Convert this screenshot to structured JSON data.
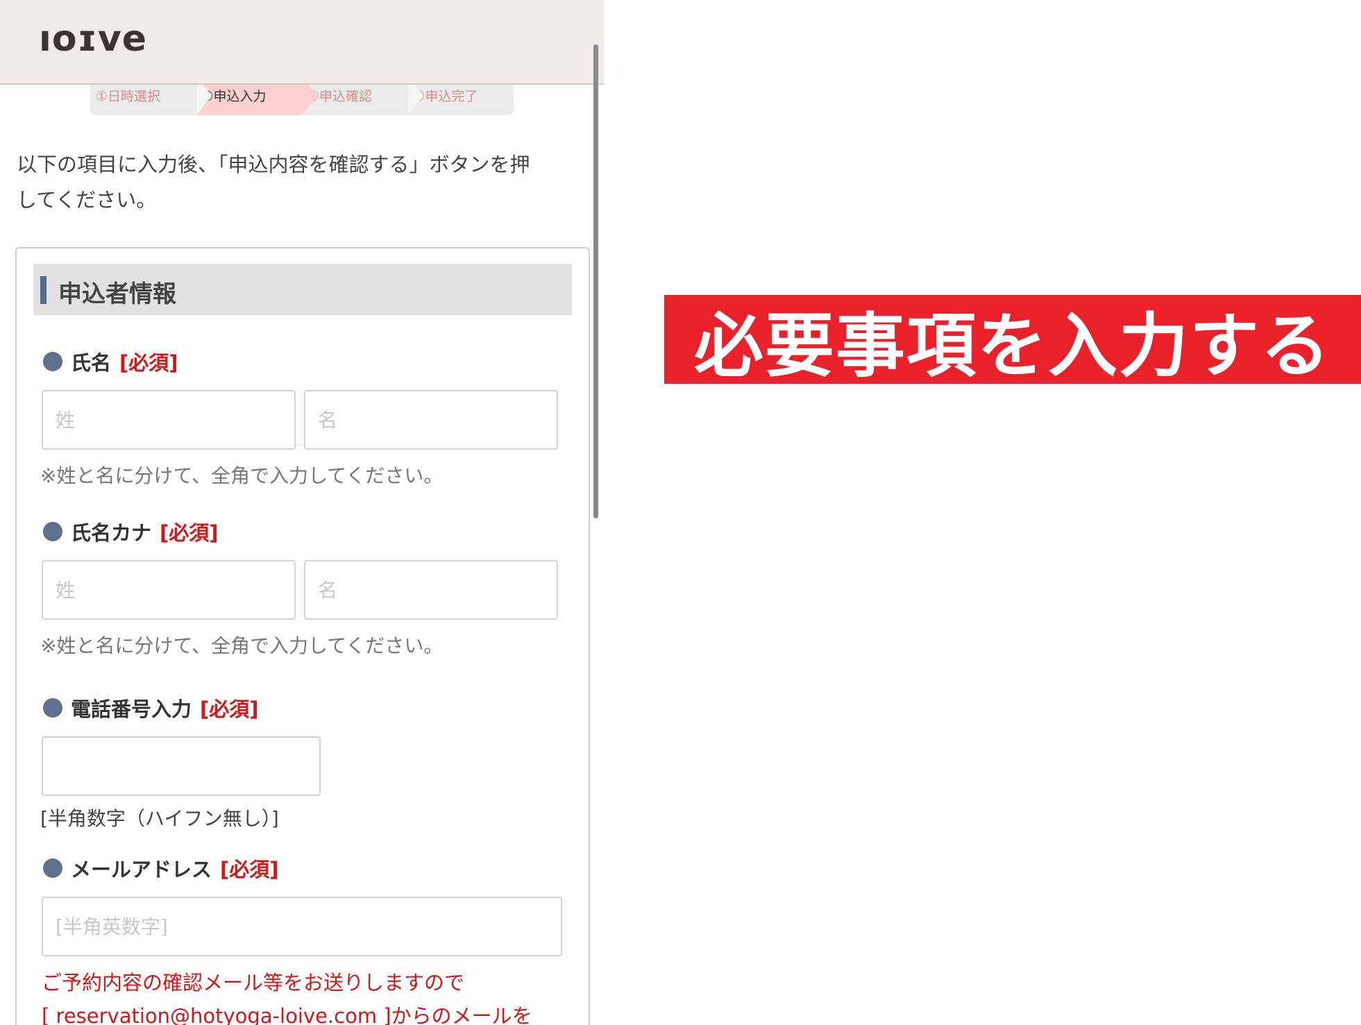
{
  "header": {
    "logo": "ıoɪve"
  },
  "steps": [
    {
      "label": "①日時選択",
      "active": false
    },
    {
      "label": "②申込入力",
      "active": true
    },
    {
      "label": "③申込確認",
      "active": false
    },
    {
      "label": "④申込完了",
      "active": false
    }
  ],
  "intro": {
    "line1": "以下の項目に入力後、「申込内容を確認する」ボタンを押",
    "line2": "してください。"
  },
  "section": {
    "title": "申込者情報"
  },
  "fields": {
    "required_tag": "[必須]",
    "name": {
      "label": "氏名",
      "last_placeholder": "姓",
      "first_placeholder": "名",
      "note": "※姓と名に分けて、全角で入力してください。"
    },
    "kana": {
      "label": "氏名カナ",
      "last_placeholder": "姓",
      "first_placeholder": "名",
      "note": "※姓と名に分けて、全角で入力してください。"
    },
    "phone": {
      "label": "電話番号入力",
      "placeholder": "",
      "note": "[半角数字（ハイフン無し）]"
    },
    "email": {
      "label": "メールアドレス",
      "placeholder": "[半角英数字]",
      "warn_line1": "ご予約内容の確認メール等をお送りしますので",
      "warn_line2": "[ reservation@hotyoga-loive.com ]からのメールを"
    }
  },
  "banner": {
    "text": "必要事項を入力する"
  },
  "colors": {
    "header_bg": "#f0ebe7",
    "active_step": "#fcd0d0",
    "required_red": "#d01818",
    "bullet_blue": "#5f6f8c",
    "banner_red": "#e8212b"
  }
}
